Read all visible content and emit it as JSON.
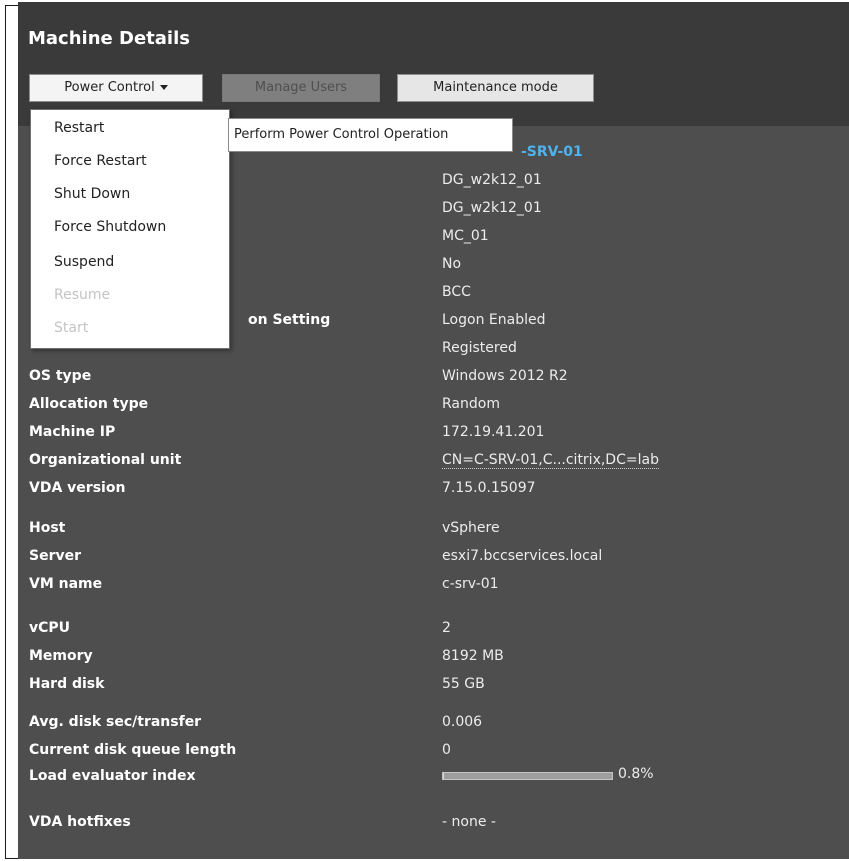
{
  "panel": {
    "title": "Machine Details"
  },
  "toolbar": {
    "power_control_label": "Power Control",
    "manage_users_label": "Manage Users",
    "maintenance_mode_label": "Maintenance mode"
  },
  "power_menu": {
    "items": [
      {
        "label": "Restart",
        "enabled": true
      },
      {
        "label": "Force Restart",
        "enabled": true
      },
      {
        "label": "Shut Down",
        "enabled": true
      },
      {
        "label": "Force Shutdown",
        "enabled": true
      },
      {
        "label": "Suspend",
        "enabled": true
      },
      {
        "label": "Resume",
        "enabled": false
      },
      {
        "label": "Start",
        "enabled": false
      }
    ]
  },
  "tooltip": {
    "text": "Perform Power Control Operation"
  },
  "machine": {
    "name_partial": "-SRV-01"
  },
  "properties": {
    "unlabeled_values": [
      "DG_w2k12_01",
      "DG_w2k12_01",
      "MC_01",
      "No",
      "BCC"
    ],
    "logon_setting": {
      "label_partial": "on Setting",
      "value": "Logon Enabled"
    },
    "registration_state": {
      "value": "Registered"
    },
    "os_type": {
      "label": "OS type",
      "value": "Windows 2012 R2"
    },
    "allocation_type": {
      "label": "Allocation type",
      "value": "Random"
    },
    "machine_ip": {
      "label": "Machine IP",
      "value": "172.19.41.201"
    },
    "organizational_unit": {
      "label": "Organizational unit",
      "value": "CN=C-SRV-01,C...citrix,DC=lab"
    },
    "vda_version": {
      "label": "VDA version",
      "value": "7.15.0.15097"
    },
    "host": {
      "label": "Host",
      "value": "vSphere"
    },
    "server": {
      "label": "Server",
      "value": "esxi7.bccservices.local"
    },
    "vm_name": {
      "label": "VM name",
      "value": "c-srv-01"
    },
    "vcpu": {
      "label": "vCPU",
      "value": "2"
    },
    "memory": {
      "label": "Memory",
      "value": "8192 MB"
    },
    "hard_disk": {
      "label": "Hard disk",
      "value": "55 GB"
    },
    "avg_disk": {
      "label": "Avg. disk sec/transfer",
      "value": "0.006"
    },
    "disk_queue": {
      "label": "Current disk queue length",
      "value": "0"
    },
    "load_evaluator": {
      "label": "Load evaluator index",
      "value": "0.8%",
      "fraction": 0.008
    },
    "vda_hotfixes": {
      "label": "VDA hotfixes",
      "value": "- none -"
    }
  },
  "colors": {
    "panel_bg": "#4e4e4e",
    "header_bg": "#3a3a3a",
    "accent_name": "#4db3ee"
  },
  "icons": {
    "power_control_dropdown": "chevron-down-icon"
  }
}
